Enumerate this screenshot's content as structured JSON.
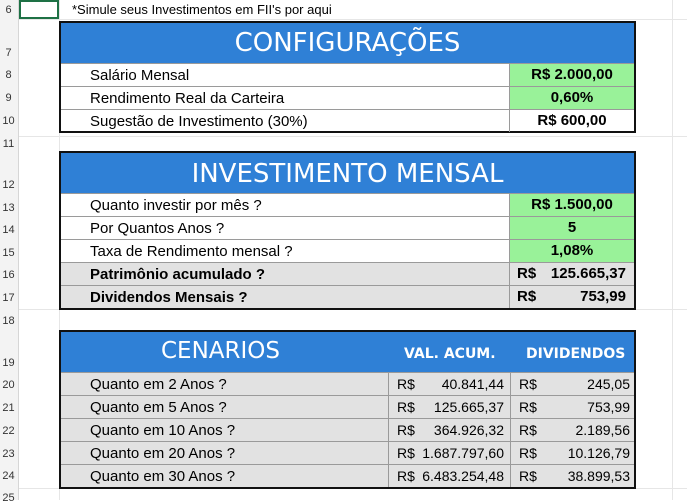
{
  "sheet": {
    "row_numbers": [
      "6",
      "7",
      "8",
      "9",
      "10",
      "11",
      "12",
      "13",
      "14",
      "15",
      "16",
      "17",
      "18",
      "19",
      "20",
      "21",
      "22",
      "23",
      "24",
      "25"
    ],
    "note": "*Simule seus Investimentos em FII's por aqui"
  },
  "config": {
    "title": "CONFIGURAÇÕES",
    "rows": [
      {
        "label": "Salário Mensal",
        "value": "R$ 2.000,00"
      },
      {
        "label": "Rendimento Real da Carteira",
        "value": "0,60%"
      },
      {
        "label": "Sugestão de Investimento (30%)",
        "value": "R$ 600,00"
      }
    ]
  },
  "investimento": {
    "title": "INVESTIMENTO MENSAL",
    "rows": [
      {
        "label": "Quanto investir por mês ?",
        "value": "R$ 1.500,00"
      },
      {
        "label": "Por Quantos Anos ?",
        "value": "5"
      },
      {
        "label": "Taxa de Rendimento mensal ?",
        "value": "1,08%"
      }
    ],
    "patrimonio": {
      "label": "Patrimônio acumulado ?",
      "currency": "R$",
      "value": "125.665,37"
    },
    "dividendos": {
      "label": "Dividendos Mensais ?",
      "currency": "R$",
      "value": "753,99"
    }
  },
  "cenarios": {
    "title": "CENARIOS",
    "col_acum": "VAL. ACUM.",
    "col_div": "DIVIDENDOS",
    "rows": [
      {
        "label": "Quanto em 2 Anos ?",
        "cur1": "R$",
        "acum": "40.841,44",
        "cur2": "R$",
        "div": "245,05"
      },
      {
        "label": "Quanto em 5 Anos ?",
        "cur1": "R$",
        "acum": "125.665,37",
        "cur2": "R$",
        "div": "753,99"
      },
      {
        "label": "Quanto em 10 Anos ?",
        "cur1": "R$",
        "acum": "364.926,32",
        "cur2": "R$",
        "div": "2.189,56"
      },
      {
        "label": "Quanto em 20 Anos ?",
        "cur1": "R$",
        "acum": "1.687.797,60",
        "cur2": "R$",
        "div": "10.126,79"
      },
      {
        "label": "Quanto em 30 Anos ?",
        "cur1": "R$",
        "acum": "6.483.254,48",
        "cur2": "R$",
        "div": "38.899,53"
      }
    ]
  },
  "colors": {
    "header_blue": "#2f80d6",
    "value_green": "#99f299",
    "row_grey": "#e2e2e2",
    "selection": "#1e7145"
  }
}
